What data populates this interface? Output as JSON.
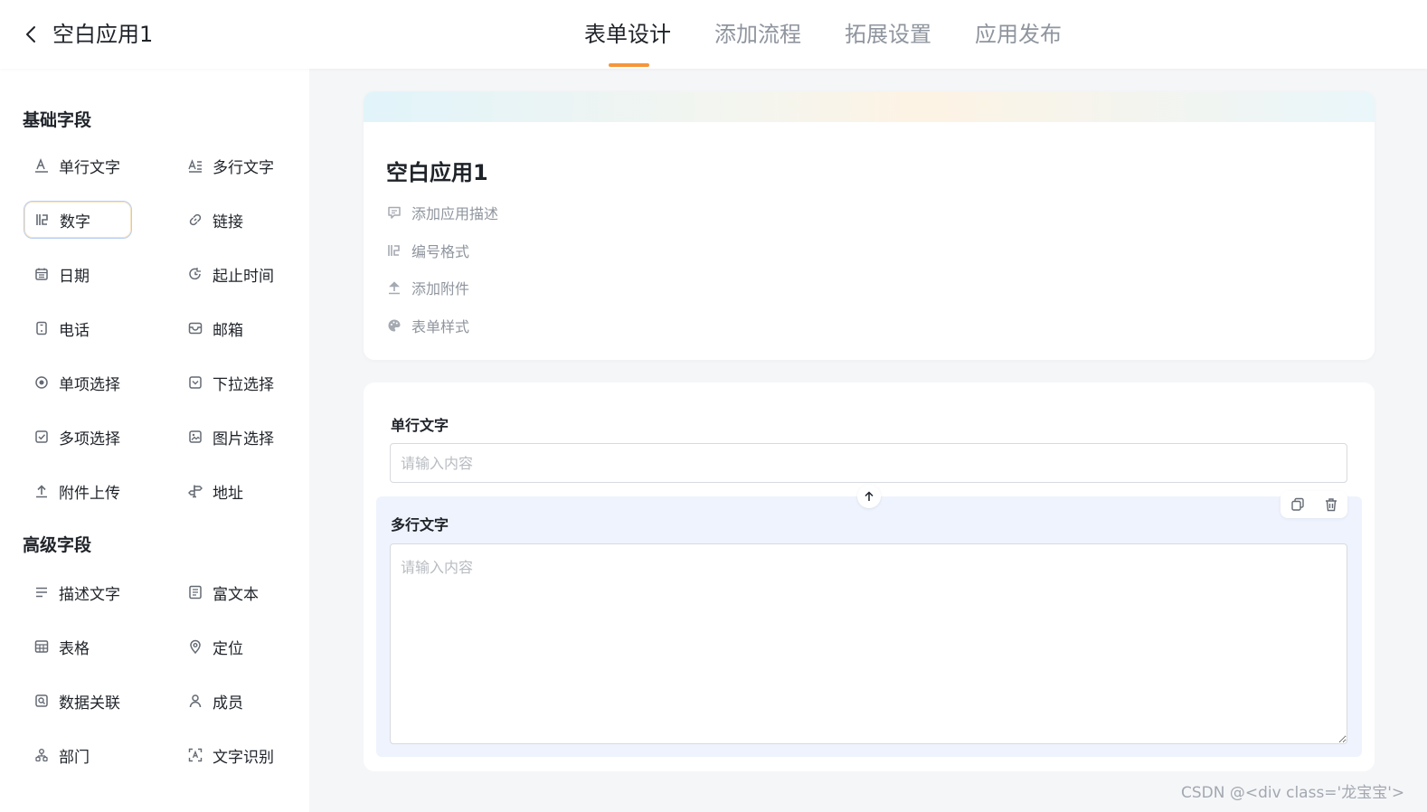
{
  "header": {
    "app_title": "空白应用1",
    "tabs": [
      {
        "label": "表单设计",
        "active": true
      },
      {
        "label": "添加流程",
        "active": false
      },
      {
        "label": "拓展设置",
        "active": false
      },
      {
        "label": "应用发布",
        "active": false
      }
    ],
    "tab_underline_color": "#f5963b"
  },
  "sidebar": {
    "basic_title": "基础字段",
    "basic_fields": [
      {
        "label": "单行文字",
        "icon": "single-line-text-icon"
      },
      {
        "label": "多行文字",
        "icon": "multi-line-text-icon"
      },
      {
        "label": "数字",
        "icon": "number-icon",
        "selected": true
      },
      {
        "label": "链接",
        "icon": "link-icon"
      },
      {
        "label": "日期",
        "icon": "calendar-icon"
      },
      {
        "label": "起止时间",
        "icon": "time-range-icon"
      },
      {
        "label": "电话",
        "icon": "phone-icon"
      },
      {
        "label": "邮箱",
        "icon": "mail-icon"
      },
      {
        "label": "单项选择",
        "icon": "radio-icon"
      },
      {
        "label": "下拉选择",
        "icon": "dropdown-icon"
      },
      {
        "label": "多项选择",
        "icon": "checkbox-icon"
      },
      {
        "label": "图片选择",
        "icon": "image-icon"
      },
      {
        "label": "附件上传",
        "icon": "upload-icon"
      },
      {
        "label": "地址",
        "icon": "signpost-icon"
      }
    ],
    "advanced_title": "高级字段",
    "advanced_fields": [
      {
        "label": "描述文字",
        "icon": "description-icon"
      },
      {
        "label": "富文本",
        "icon": "rich-text-icon"
      },
      {
        "label": "表格",
        "icon": "table-icon"
      },
      {
        "label": "定位",
        "icon": "location-pin-icon"
      },
      {
        "label": "数据关联",
        "icon": "data-link-icon"
      },
      {
        "label": "成员",
        "icon": "user-icon"
      },
      {
        "label": "部门",
        "icon": "department-icon"
      },
      {
        "label": "文字识别",
        "icon": "text-scan-icon"
      }
    ]
  },
  "form_header": {
    "title": "空白应用1",
    "options": [
      {
        "label": "添加应用描述",
        "icon": "comment-icon"
      },
      {
        "label": "编号格式",
        "icon": "number-icon"
      },
      {
        "label": "添加附件",
        "icon": "upload-icon"
      },
      {
        "label": "表单样式",
        "icon": "palette-icon"
      }
    ]
  },
  "form_fields": {
    "single_line": {
      "label": "单行文字",
      "placeholder": "请输入内容",
      "value": ""
    },
    "multi_line": {
      "label": "多行文字",
      "placeholder": "请输入内容",
      "value": ""
    }
  },
  "watermark": "CSDN @<div class='龙宝宝'>"
}
